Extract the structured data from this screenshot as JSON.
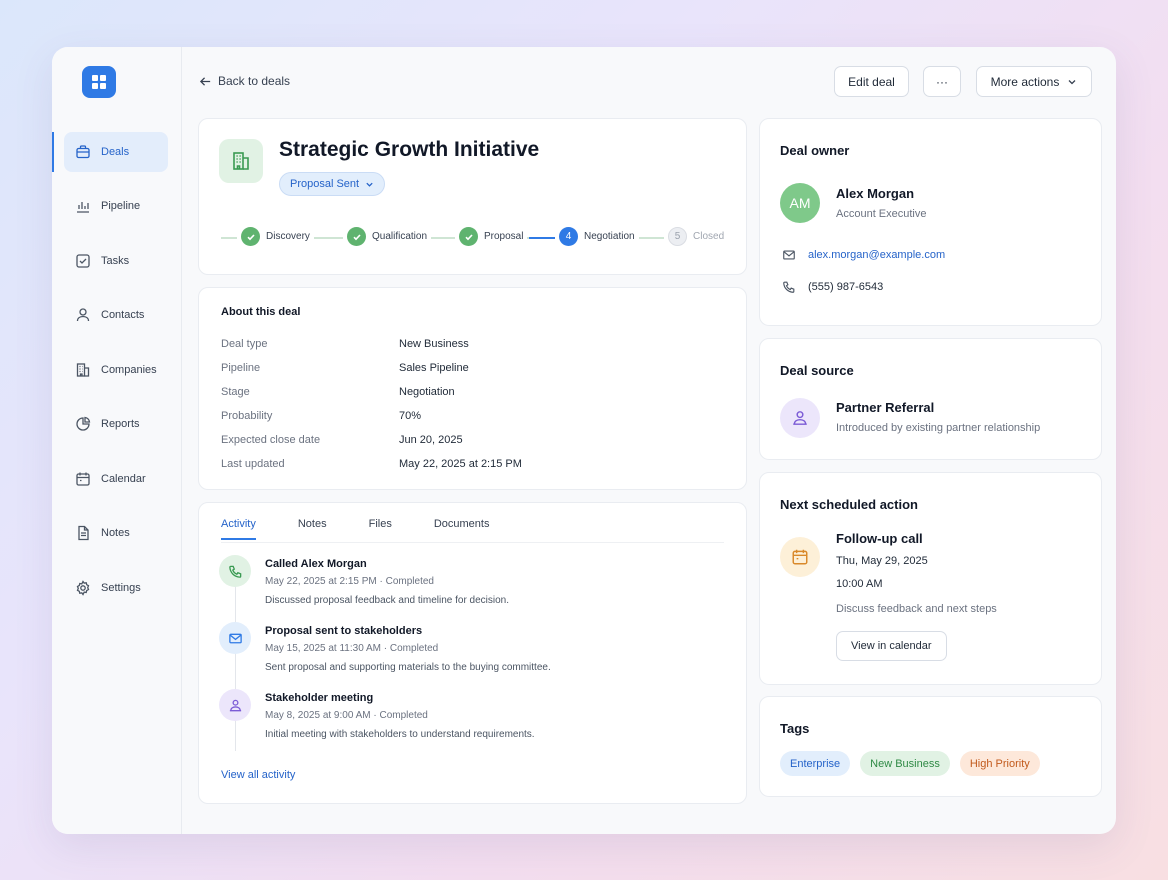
{
  "colors": {
    "accent": "#2f7ae5",
    "success": "#5fb36f",
    "tag_enterprise_bg": "#e2eefc",
    "tag_enterprise_fg": "#2563c9",
    "tag_newbusiness_bg": "#e1f2e4",
    "tag_newbusiness_fg": "#2f8a45",
    "tag_highpriority_bg": "#fde8da",
    "tag_highpriority_fg": "#c25a1c"
  },
  "sidebar": {
    "logo_icon": "grid-icon",
    "items": [
      {
        "label": "Deals",
        "icon": "briefcase-icon",
        "active": true
      },
      {
        "label": "Pipeline",
        "icon": "bar-chart-icon"
      },
      {
        "label": "Tasks",
        "icon": "checkbox-icon"
      },
      {
        "label": "Contacts",
        "icon": "user-icon"
      },
      {
        "label": "Companies",
        "icon": "building-icon"
      },
      {
        "label": "Reports",
        "icon": "pie-chart-icon"
      },
      {
        "label": "Calendar",
        "icon": "calendar-icon"
      },
      {
        "label": "Notes",
        "icon": "document-icon"
      },
      {
        "label": "Settings",
        "icon": "gear-icon"
      }
    ]
  },
  "topbar": {
    "back_label": "Back to deals",
    "edit_label": "Edit deal",
    "more_dots": "···",
    "more_actions_label": "More actions"
  },
  "deal": {
    "title": "Strategic Growth Initiative",
    "stage_pill": "Proposal Sent",
    "steps": [
      {
        "label": "Discovery",
        "status": "done"
      },
      {
        "label": "Qualification",
        "status": "done"
      },
      {
        "label": "Proposal",
        "status": "done"
      },
      {
        "label": "Negotiation",
        "status": "current",
        "number": "4"
      },
      {
        "label": "Closed",
        "status": "todo",
        "number": "5"
      }
    ]
  },
  "about": {
    "heading": "About this deal",
    "rows": [
      {
        "key": "Deal type",
        "value": "New Business"
      },
      {
        "key": "Pipeline",
        "value": "Sales Pipeline"
      },
      {
        "key": "Stage",
        "value": "Negotiation"
      },
      {
        "key": "Probability",
        "value": "70%"
      },
      {
        "key": "Expected close date",
        "value": "Jun 20, 2025"
      },
      {
        "key": "Last updated",
        "value": "May 22, 2025 at 2:15 PM"
      }
    ]
  },
  "activity": {
    "tabs": [
      "Activity",
      "Notes",
      "Files",
      "Documents"
    ],
    "items": [
      {
        "title": "Called Alex Morgan",
        "meta": "May 22, 2025 at 2:15 PM · Completed",
        "desc": "Discussed proposal feedback and timeline for decision.",
        "icon": "phone-icon"
      },
      {
        "title": "Proposal sent to stakeholders",
        "meta": "May 15, 2025 at 11:30 AM · Completed",
        "desc": "Sent proposal and supporting materials to the buying committee.",
        "icon": "mail-icon"
      },
      {
        "title": "Stakeholder meeting",
        "meta": "May 8, 2025 at 9:00 AM · Completed",
        "desc": "Initial meeting with stakeholders to understand requirements.",
        "icon": "meeting-icon"
      }
    ],
    "view_all": "View all activity"
  },
  "owner": {
    "heading": "Deal owner",
    "initials": "AM",
    "name": "Alex Morgan",
    "role": "Account Executive",
    "email": "alex.morgan@example.com",
    "phone": "(555) 987-6543"
  },
  "source": {
    "heading": "Deal source",
    "name": "Partner Referral",
    "desc": "Introduced by existing partner relationship"
  },
  "next_action": {
    "heading": "Next scheduled action",
    "title": "Follow-up call",
    "date": "Thu, May 29, 2025",
    "time": "10:00 AM",
    "desc": "Discuss feedback and next steps",
    "button": "View in calendar"
  },
  "tags": {
    "heading": "Tags",
    "items": [
      "Enterprise",
      "New Business",
      "High Priority"
    ]
  }
}
